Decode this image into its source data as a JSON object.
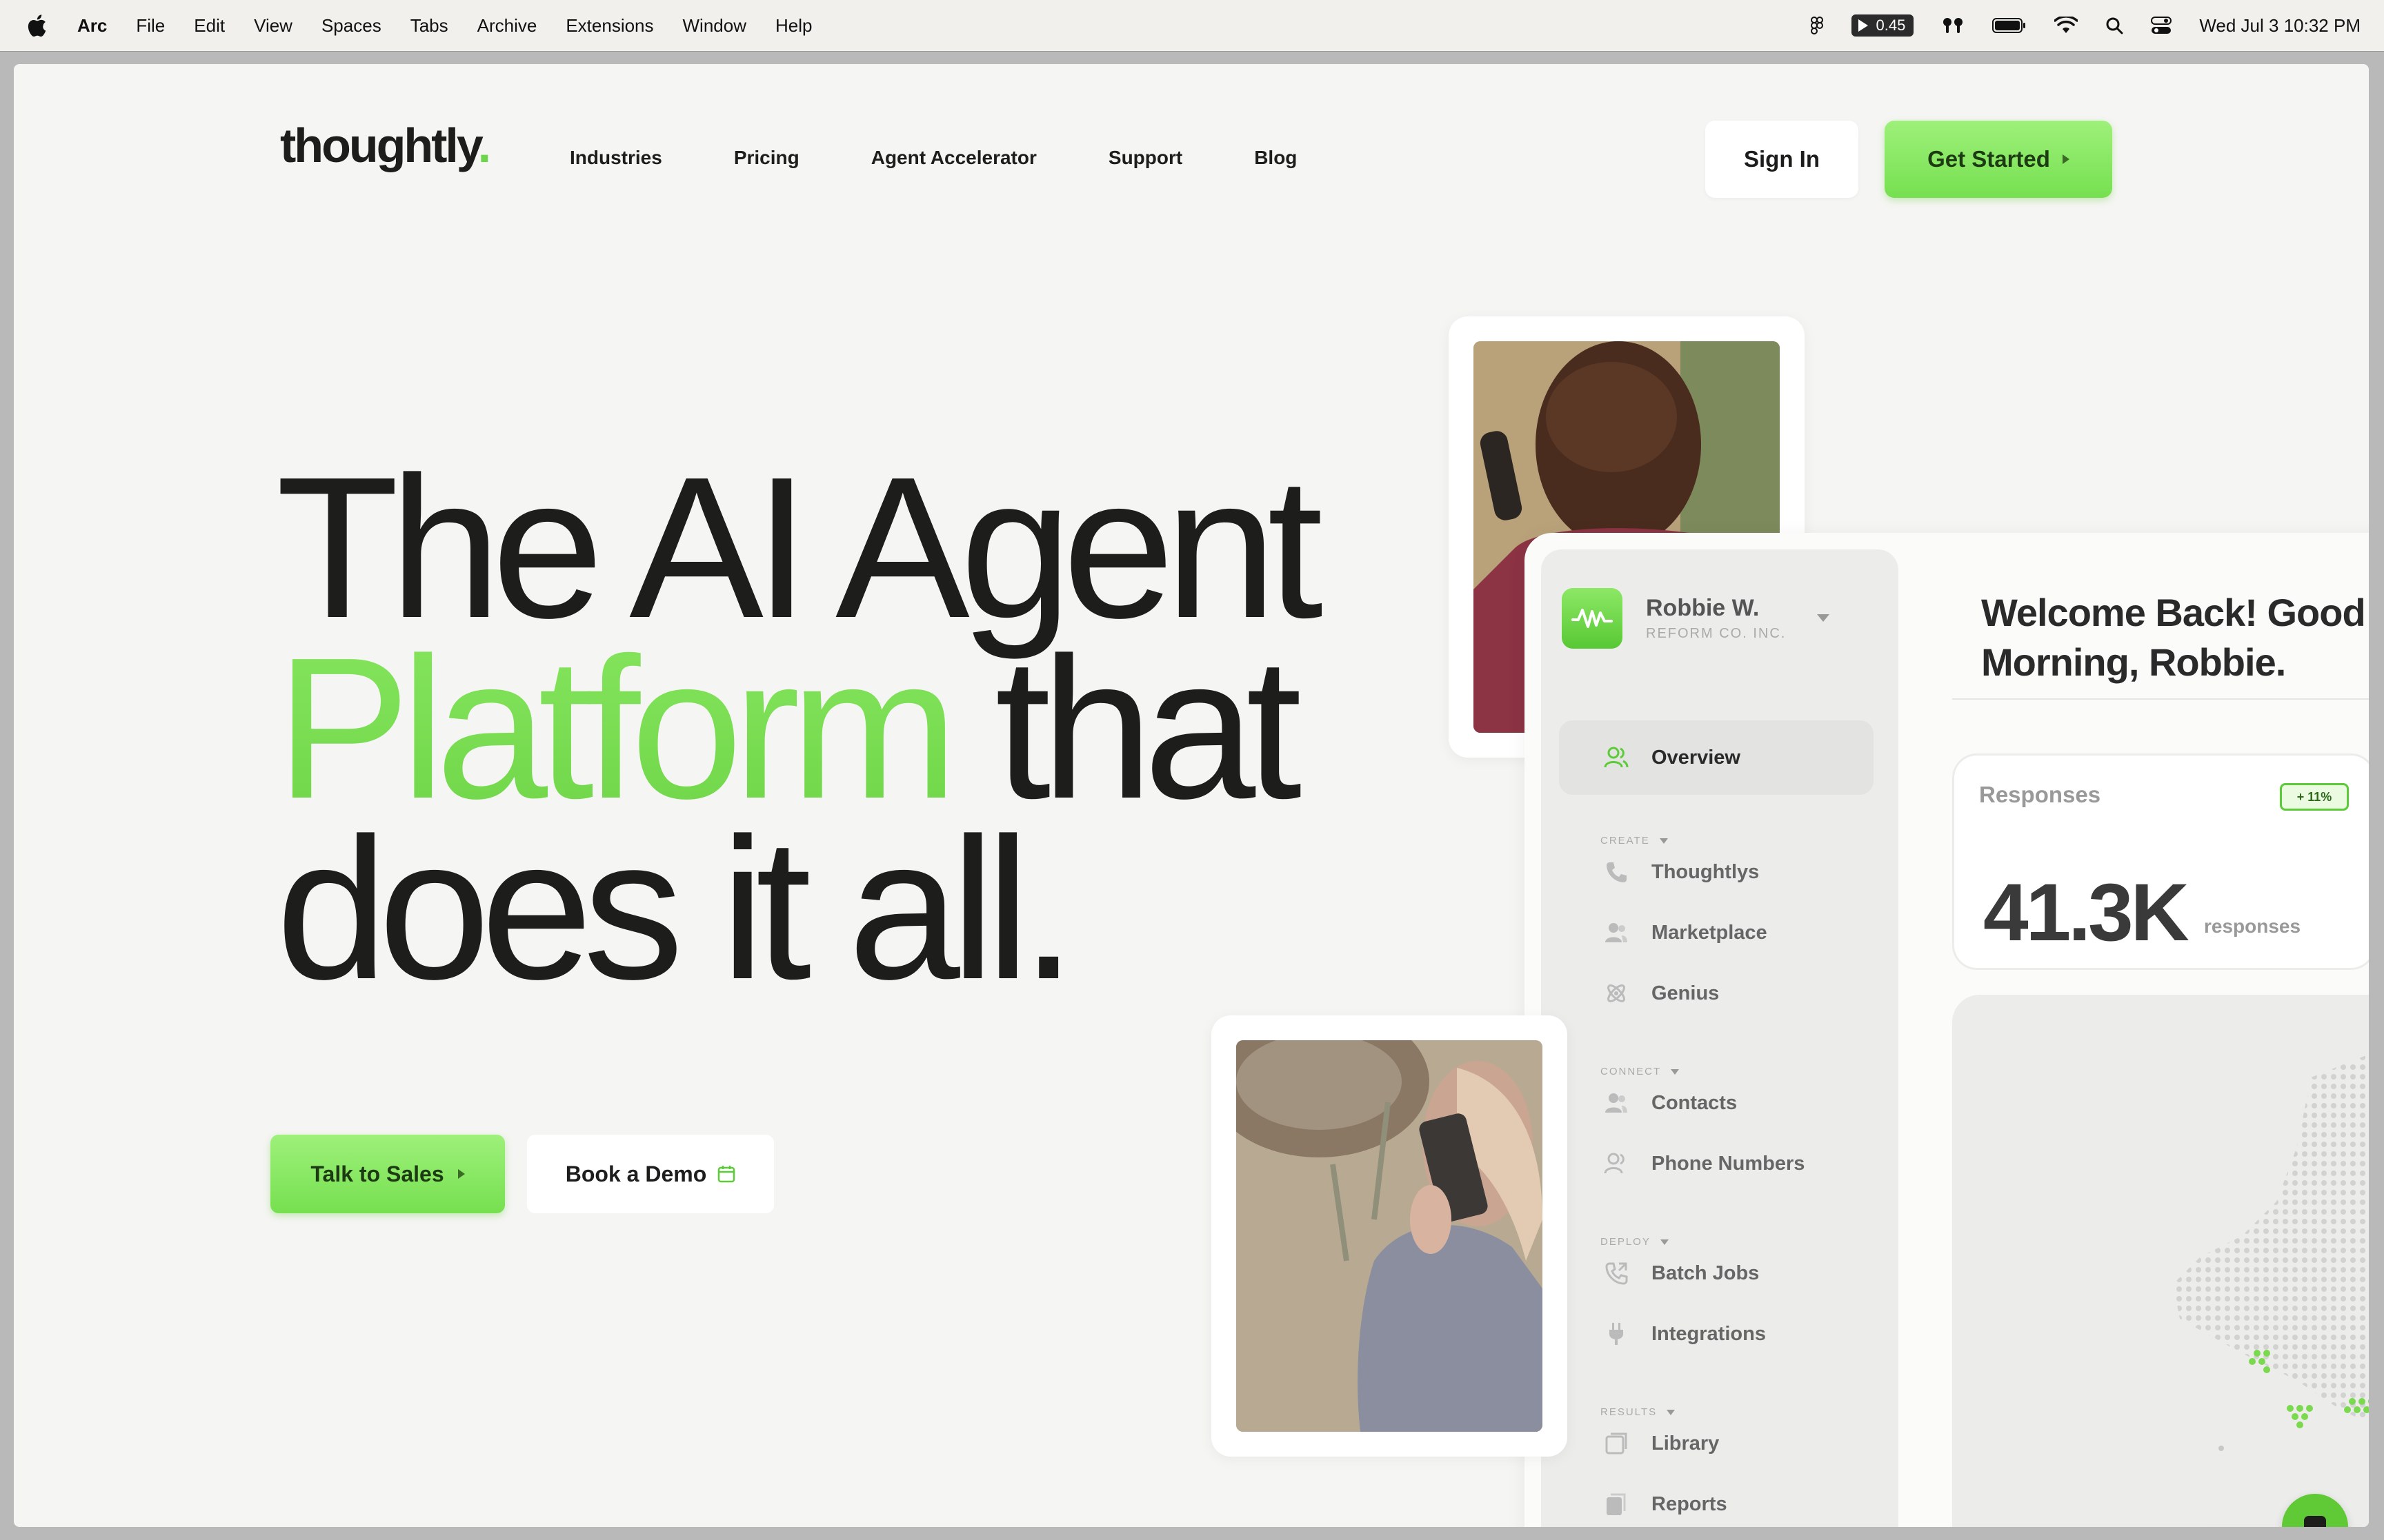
{
  "menubar": {
    "app_name": "Arc",
    "items": [
      "File",
      "Edit",
      "View",
      "Spaces",
      "Tabs",
      "Archive",
      "Extensions",
      "Window",
      "Help"
    ],
    "timer": "0.45",
    "datetime": "Wed Jul 3  10:32 PM"
  },
  "site": {
    "logo": "thoughtly",
    "nav": [
      "Industries",
      "Pricing",
      "Agent Accelerator",
      "Support",
      "Blog"
    ],
    "sign_in": "Sign In",
    "get_started": "Get Started"
  },
  "hero": {
    "line1": "The AI Agent",
    "line2_green": "Platform",
    "line2_rest": " that",
    "line3": "does it all.",
    "cta_primary": "Talk to Sales",
    "cta_secondary": "Book a Demo"
  },
  "dashboard": {
    "user": {
      "name": "Robbie W.",
      "company": "REFORM CO. INC."
    },
    "nav_active": "Overview",
    "sections": {
      "create": "CREATE",
      "connect": "CONNECT",
      "deploy": "DEPLOY",
      "results": "RESULTS"
    },
    "items": {
      "thoughtlys": "Thoughtlys",
      "marketplace": "Marketplace",
      "genius": "Genius",
      "contacts": "Contacts",
      "phone_numbers": "Phone Numbers",
      "batch_jobs": "Batch Jobs",
      "integrations": "Integrations",
      "library": "Library",
      "reports": "Reports"
    },
    "welcome": "Welcome Back! Good Morning, Robbie.",
    "responses": {
      "label": "Responses",
      "badge": "+ 11%",
      "value": "41.3K",
      "unit": "responses"
    }
  },
  "colors": {
    "accent_green": "#76dc4c",
    "text_dark": "#1d1d1b",
    "page_bg": "#f5f5f3"
  }
}
